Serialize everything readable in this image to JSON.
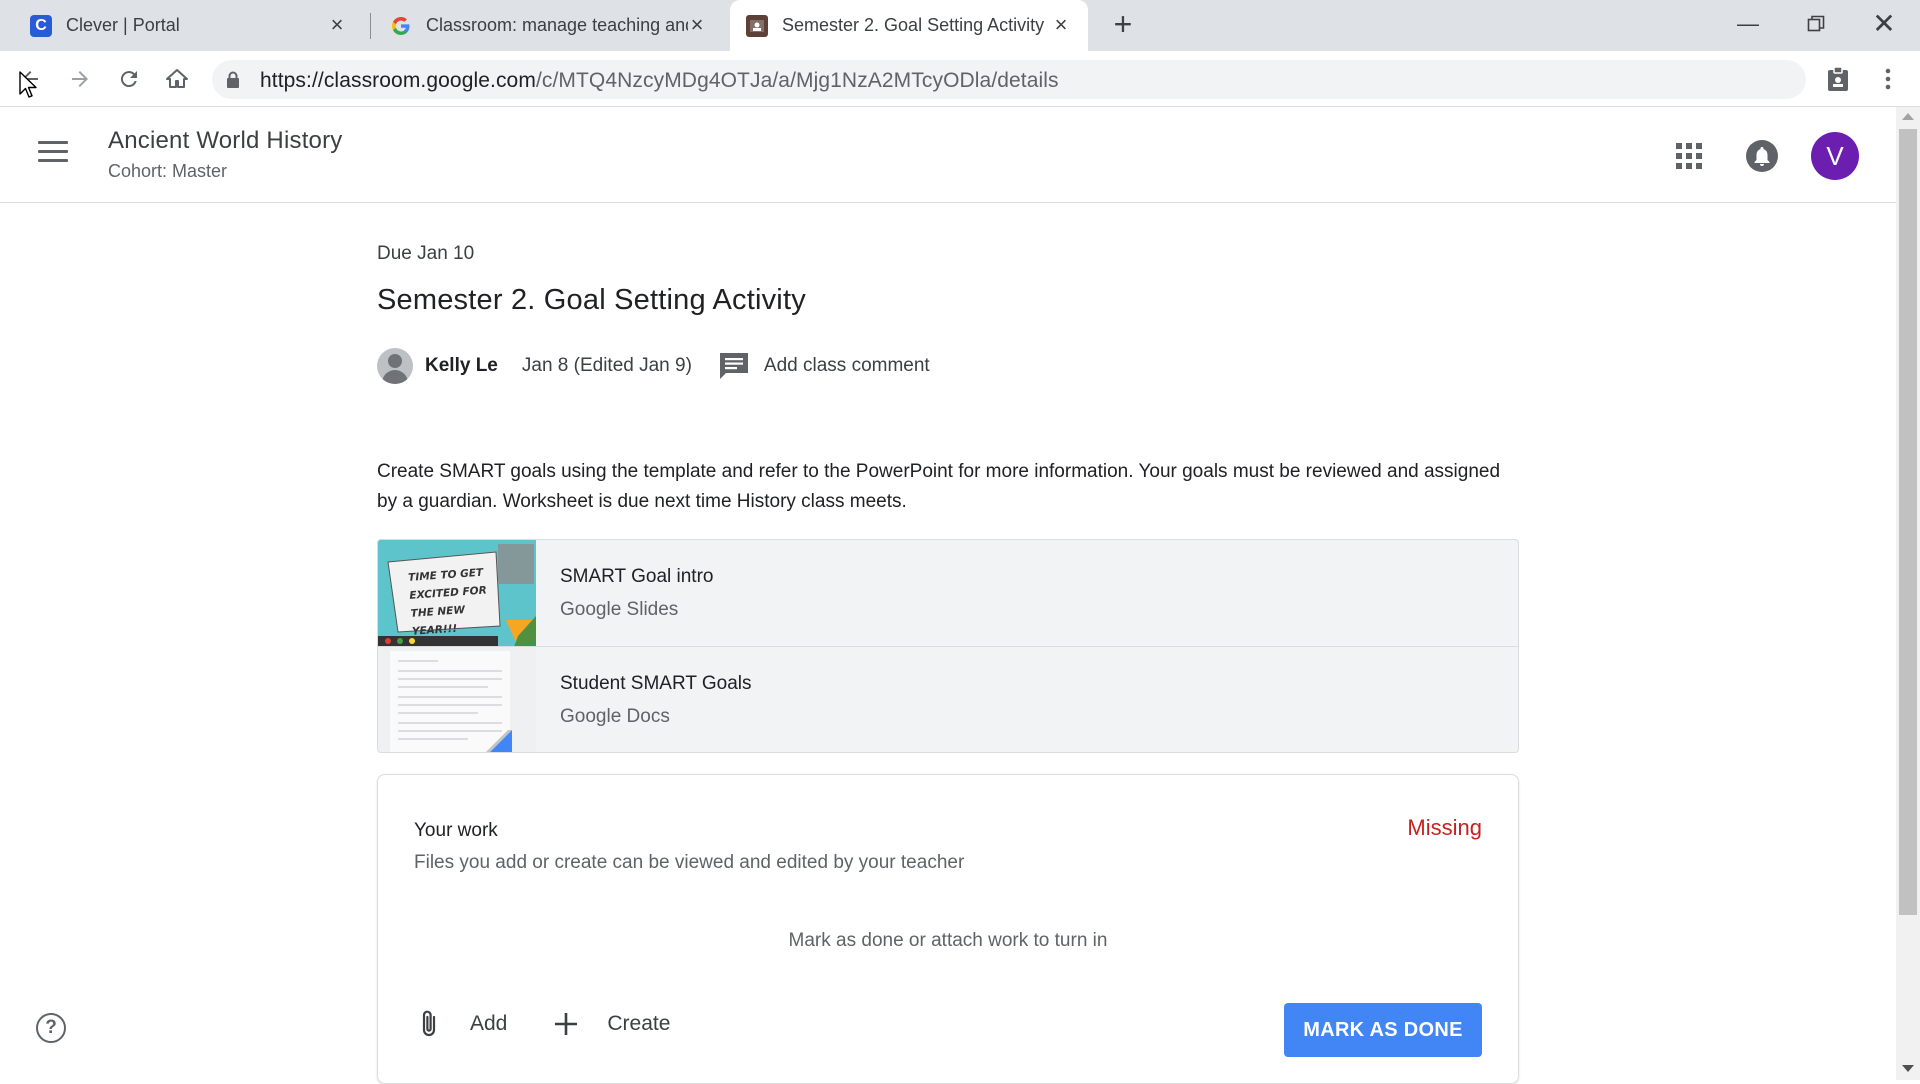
{
  "browser": {
    "tabs": [
      {
        "title": "Clever | Portal",
        "favicon": "clever-icon",
        "active": false
      },
      {
        "title": "Classroom: manage teaching and",
        "favicon": "google-icon",
        "active": false
      },
      {
        "title": "Semester 2. Goal Setting Activity",
        "favicon": "classroom-icon",
        "active": true
      }
    ],
    "url_host": "https://classroom.google.com",
    "url_path": "/c/MTQ4NzcyMDg4OTJa/a/Mjg1NzA2MTcyODla/details"
  },
  "header": {
    "course_title": "Ancient World History",
    "course_subtitle": "Cohort: Master",
    "avatar_letter": "V"
  },
  "assignment": {
    "due": "Due Jan 10",
    "title": "Semester 2. Goal Setting Activity",
    "author": "Kelly Le",
    "posted": "Jan 8 (Edited Jan 9)",
    "comment_label": "Add class comment",
    "description": "Create SMART goals using the template and refer to the PowerPoint for more information. Your goals must be reviewed and assigned by a guardian. Worksheet is due next time History class meets.",
    "materials": [
      {
        "title": "SMART Goal intro",
        "type": "Google Slides",
        "thumb_text": "TIME TO GET EXCITED FOR THE NEW YEAR!!!"
      },
      {
        "title": "Student SMART Goals",
        "type": "Google Docs"
      }
    ]
  },
  "your_work": {
    "title": "Your work",
    "status": "Missing",
    "subtitle": "Files you add or create can be viewed and edited by your teacher",
    "empty_text": "Mark as done or attach work to turn in",
    "add_label": "Add",
    "create_label": "Create",
    "mark_done_label": "MARK AS DONE"
  },
  "colors": {
    "accent": "#4285f4",
    "missing": "#c5221f",
    "avatar": "#6b1eb0"
  }
}
